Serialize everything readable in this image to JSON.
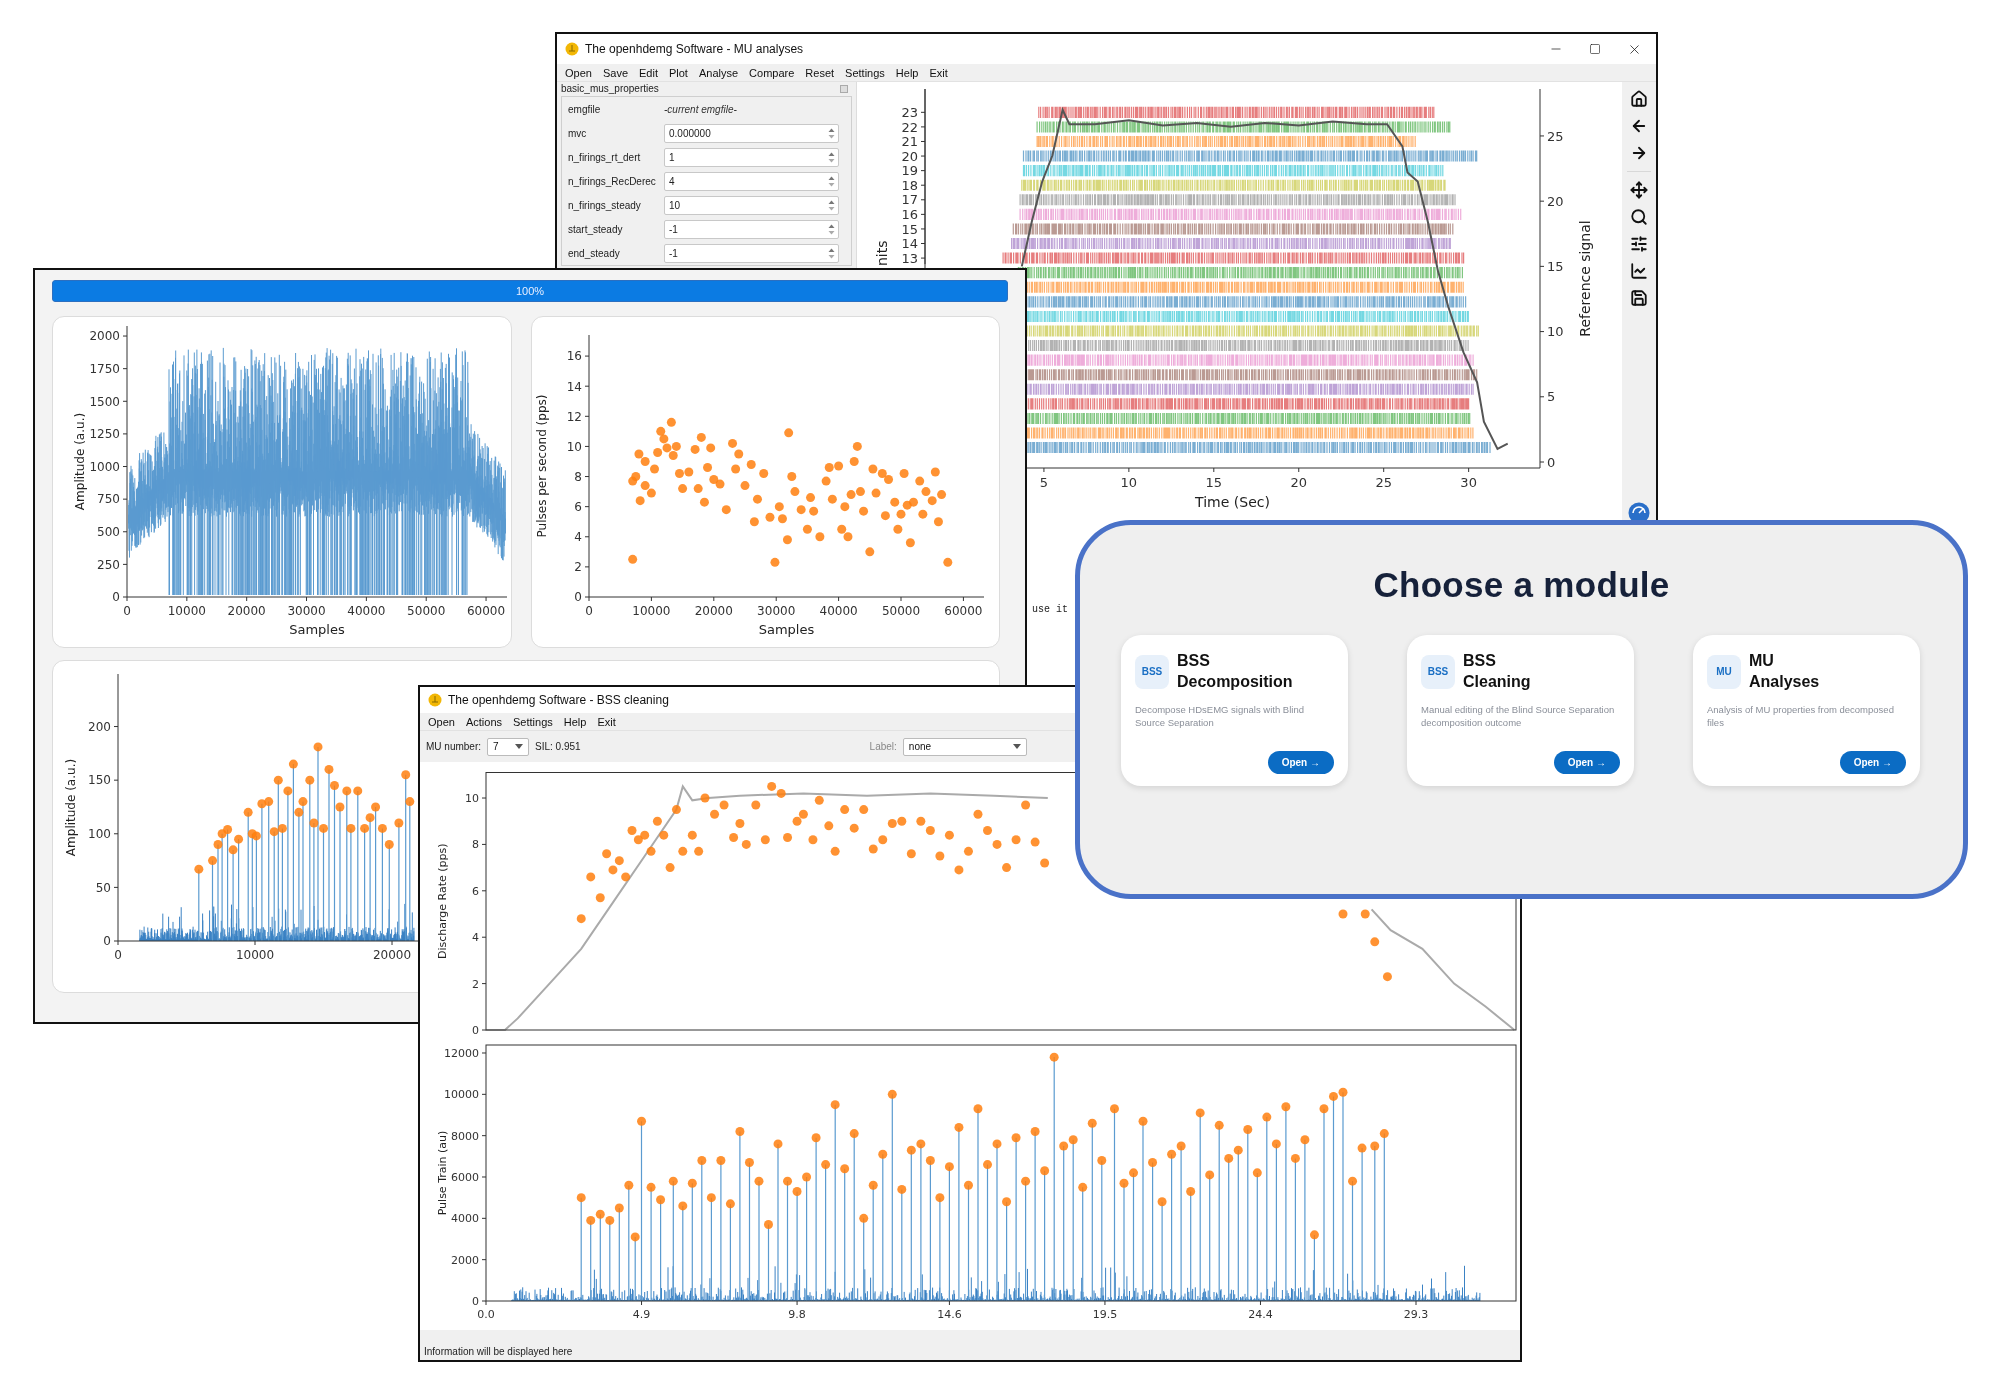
{
  "mu_window": {
    "title": "The openhdemg Software - MU analyses",
    "menu": [
      "Open",
      "Save",
      "Edit",
      "Plot",
      "Analyse",
      "Compare",
      "Reset",
      "Settings",
      "Help",
      "Exit"
    ],
    "panel": {
      "title": "basic_mus_properties",
      "fields": [
        {
          "label": "emgfile",
          "value": "-current emgfile-",
          "kind": "text"
        },
        {
          "label": "mvc",
          "value": "0.000000",
          "kind": "spin"
        },
        {
          "label": "n_firings_rt_dert",
          "value": "1",
          "kind": "spin"
        },
        {
          "label": "n_firings_RecDerec",
          "value": "4",
          "kind": "spin"
        },
        {
          "label": "n_firings_steady",
          "value": "10",
          "kind": "spin"
        },
        {
          "label": "start_steady",
          "value": "-1",
          "kind": "spin"
        },
        {
          "label": "end_steady",
          "value": "-1",
          "kind": "spin"
        }
      ]
    },
    "plot": {
      "kind": "raster",
      "unit_axis": {
        "label": "nits",
        "ticks": [
          "23",
          "22",
          "21",
          "20",
          "19",
          "18",
          "17",
          "16",
          "15",
          "14",
          "13"
        ]
      },
      "chart_data": {
        "type": "line",
        "xlabel": "Time (Sec)",
        "ylabel": "Reference signal",
        "xlim": [
          -2,
          34.2
        ],
        "ylim": [
          -0.46,
          28.6
        ],
        "xticks": [
          5,
          10,
          15,
          20,
          25,
          30
        ],
        "yticks": [
          0,
          5,
          10,
          15,
          20,
          25
        ],
        "series": [
          {
            "color": "#555555",
            "x": [
              3.7,
              4.3,
              4.9,
              5.5,
              6.1,
              6.5,
              8,
              10,
              12,
              14,
              16,
              18,
              20,
              22,
              24,
              25.2,
              26.1,
              26.4,
              27,
              27.6,
              28.2,
              28.8,
              29.7,
              30.5,
              30.9,
              31.7,
              32.3
            ],
            "values": [
              15,
              18.5,
              21.5,
              23.5,
              27,
              25.9,
              25.9,
              26.2,
              25.8,
              26,
              25.7,
              26,
              25.8,
              26.1,
              25.9,
              25.9,
              24.2,
              22.2,
              21.5,
              18.4,
              14.6,
              11.9,
              8.4,
              6.1,
              3.1,
              1.0,
              1.4
            ]
          }
        ]
      }
    },
    "console_text": "use it"
  },
  "progress_window": {
    "progress": {
      "label": "100%",
      "level": 1
    },
    "plots": [
      {
        "kind": "emg",
        "chart_data": {
          "type": "line",
          "xlabel": "Samples",
          "ylabel": "Amplitude (a.u.)",
          "xlim": [
            0,
            63500
          ],
          "ylim": [
            0,
            2077
          ],
          "xticks": [
            0,
            10000,
            20000,
            30000,
            40000,
            50000,
            60000
          ],
          "yticks": [
            0,
            250,
            500,
            750,
            1000,
            1250,
            1500,
            1750,
            2000
          ]
        }
      },
      {
        "kind": "plain",
        "chart_data": {
          "type": "scatter",
          "xlabel": "Samples",
          "ylabel": "Pulses per second (pps)",
          "xlim": [
            0,
            63300
          ],
          "ylim": [
            0,
            17.4
          ],
          "xticks": [
            0,
            10000,
            20000,
            30000,
            40000,
            50000,
            60000
          ],
          "yticks": [
            0,
            2,
            4,
            6,
            8,
            10,
            12,
            14,
            16
          ],
          "series": [
            {
              "color": "#ff7f0e",
              "x": [
                7000,
                7000,
                7500,
                8000,
                8200,
                9000,
                9000,
                10000,
                10500,
                11000,
                11500,
                12000,
                12500,
                13200,
                13500,
                14000,
                14500,
                15000,
                16000,
                17000,
                17500,
                18000,
                18500,
                19000,
                19500,
                20000,
                21000,
                22000,
                23000,
                23500,
                24000,
                25000,
                26000,
                26500,
                27000,
                28000,
                29000,
                29800,
                30500,
                31000,
                31800,
                32000,
                32500,
                33000,
                34000,
                35000,
                35500,
                36000,
                37000,
                38000,
                38500,
                39000,
                40000,
                40500,
                41000,
                41500,
                42000,
                42500,
                43000,
                43500,
                44000,
                45000,
                45500,
                46000,
                47000,
                47500,
                48000,
                49000,
                49500,
                50000,
                50500,
                51000,
                51500,
                52000,
                53000,
                53500,
                54000,
                55000,
                55500,
                56000,
                56500,
                57500
              ],
              "values": [
                2.5,
                7.7,
                8,
                9.5,
                6.4,
                9,
                7.4,
                6.9,
                8.5,
                9.6,
                11,
                10.5,
                9.9,
                11.6,
                9.4,
                10,
                8.2,
                7.2,
                8.3,
                9.8,
                7.2,
                10.6,
                6.3,
                8.6,
                9.9,
                7.8,
                7.5,
                5.8,
                10.2,
                8.5,
                9.5,
                7.4,
                8.8,
                5,
                6.5,
                8.2,
                5.3,
                2.3,
                6,
                5.2,
                3.8,
                10.9,
                8,
                7,
                5.8,
                4.5,
                6.6,
                5.7,
                4,
                7.7,
                8.6,
                6.5,
                8.7,
                4.5,
                6,
                4,
                6.8,
                9,
                10,
                7,
                5.7,
                3,
                8.5,
                6.9,
                8.2,
                5.4,
                7.8,
                6.3,
                4.5,
                5.5,
                8.2,
                6.1,
                3.6,
                6.3,
                7.7,
                5.5,
                7,
                6.4,
                8.3,
                5,
                6.8,
                2.3
              ]
            }
          ]
        }
      },
      {
        "kind": "stem_noise",
        "chart_data": {
          "type": "scatter",
          "ylabel": "Amplitude (a.u.)",
          "xlim": [
            0,
            63500
          ],
          "ylim": [
            0,
            249
          ],
          "xticks": [
            0,
            10000,
            20000
          ],
          "yticks": [
            0,
            50,
            100,
            150,
            200
          ],
          "series": [
            {
              "color": "#ff7f0e",
              "x": [
                5900,
                6900,
                7300,
                7600,
                8000,
                8400,
                8800,
                9500,
                9800,
                10100,
                10500,
                11000,
                11400,
                11700,
                12000,
                12400,
                12800,
                13200,
                13500,
                14000,
                14300,
                14600,
                15000,
                15400,
                15800,
                16200,
                16700,
                17000,
                17500,
                18000,
                18400,
                18800,
                19300,
                19800,
                20500,
                21000,
                21300
              ],
              "values": [
                67,
                75,
                90,
                100,
                104,
                85,
                95,
                120,
                100,
                98,
                128,
                130,
                102,
                150,
                105,
                140,
                165,
                120,
                130,
                150,
                110,
                181,
                105,
                160,
                145,
                125,
                140,
                105,
                140,
                105,
                115,
                125,
                105,
                90,
                110,
                155,
                130
              ]
            }
          ]
        }
      }
    ]
  },
  "bss_window": {
    "title": "The openhdemg Software - BSS cleaning",
    "menu": [
      "Open",
      "Actions",
      "Settings",
      "Help",
      "Exit"
    ],
    "mu_number": {
      "label": "MU number:",
      "value": "7"
    },
    "sil": "SIL: 0.951",
    "label_select": {
      "label": "Label:",
      "value": "none"
    },
    "plots": [
      {
        "kind": "plain",
        "chart_data": {
          "type": "scatter",
          "ylabel": "Discharge Rate (pps)",
          "xlim": [
            0,
            32.45
          ],
          "ylim": [
            0,
            11.1
          ],
          "yticks": [
            0,
            2,
            4,
            6,
            8,
            10
          ],
          "series": [
            {
              "type": "line",
              "color": "#aaaaaa",
              "x": [
                0,
                0.6,
                1,
                2,
                3,
                4,
                5,
                6,
                6.2,
                6.5,
                7,
                8,
                10,
                12,
                14,
                16,
                17.7
              ],
              "values": [
                0,
                0,
                0.5,
                2,
                3.5,
                5.5,
                7.5,
                9.5,
                10.5,
                9.9,
                10,
                10.1,
                10.2,
                10.1,
                10.2,
                10.1,
                10.0
              ]
            },
            {
              "type": "line",
              "color": "#aaaaaa",
              "x": [
                27.9,
                28.5,
                29.5,
                30.5,
                31.5,
                32.4
              ],
              "values": [
                5.2,
                4.3,
                3.5,
                2,
                1,
                0
              ]
            },
            {
              "color": "#ff7f0e",
              "x": [
                3.0,
                3.3,
                3.6,
                3.8,
                4,
                4.2,
                4.4,
                4.6,
                4.8,
                5,
                5.2,
                5.4,
                5.6,
                5.8,
                6,
                6.2,
                6.5,
                6.7,
                6.9,
                7.2,
                7.5,
                7.8,
                8,
                8.2,
                8.5,
                8.8,
                9,
                9.3,
                9.5,
                9.8,
                10,
                10.3,
                10.5,
                10.8,
                11,
                11.3,
                11.6,
                11.9,
                12.2,
                12.5,
                12.8,
                13.1,
                13.4,
                13.7,
                14,
                14.3,
                14.6,
                14.9,
                15.2,
                15.5,
                15.8,
                16.1,
                16.4,
                16.7,
                17,
                17.3,
                17.6,
                27.0,
                27.7,
                28.0,
                28.4
              ],
              "values": [
                4.8,
                6.6,
                5.7,
                7.6,
                6.9,
                7.3,
                6.6,
                8.6,
                8.2,
                8.4,
                7.7,
                9,
                8.4,
                7,
                9.5,
                7.7,
                8.4,
                7.7,
                10,
                9.3,
                9.7,
                8.3,
                8.9,
                8,
                9.7,
                8.2,
                10.5,
                10.2,
                8.3,
                9,
                9.3,
                8.2,
                9.9,
                8.8,
                7.7,
                9.5,
                8.7,
                9.5,
                7.8,
                8.2,
                8.9,
                9,
                7.6,
                9,
                8.6,
                7.5,
                8.4,
                6.9,
                7.7,
                9.3,
                8.6,
                8,
                7,
                8.2,
                9.7,
                8.1,
                7.2,
                5,
                5,
                3.8,
                2.3
              ]
            }
          ]
        }
      },
      {
        "kind": "stem_noise",
        "chart_data": {
          "type": "scatter",
          "ylabel": "Pulse Train (au)",
          "xlim": [
            0,
            32.45
          ],
          "ylim": [
            0,
            12387
          ],
          "xticks": [
            {
              "value": 0,
              "label": "0.0"
            },
            4.9,
            9.8,
            14.6,
            19.5,
            24.4,
            29.3
          ],
          "yticks": [
            0,
            2000,
            4000,
            6000,
            8000,
            10000,
            12000
          ],
          "series": [
            {
              "color": "#ff7f0e",
              "x": [
                3.0,
                3.3,
                3.6,
                3.9,
                4.2,
                4.5,
                4.7,
                4.9,
                5.2,
                5.5,
                5.9,
                6.2,
                6.5,
                6.8,
                7.1,
                7.4,
                7.7,
                8.0,
                8.3,
                8.6,
                8.9,
                9.2,
                9.5,
                9.8,
                10.1,
                10.4,
                10.7,
                11.0,
                11.3,
                11.6,
                11.9,
                12.2,
                12.5,
                12.8,
                13.1,
                13.4,
                13.7,
                14.0,
                14.3,
                14.6,
                14.9,
                15.2,
                15.5,
                15.8,
                16.1,
                16.4,
                16.7,
                17.0,
                17.3,
                17.6,
                17.9,
                18.2,
                18.5,
                18.8,
                19.1,
                19.4,
                19.8,
                20.1,
                20.4,
                20.7,
                21.0,
                21.3,
                21.6,
                21.9,
                22.2,
                22.5,
                22.8,
                23.1,
                23.4,
                23.7,
                24.0,
                24.3,
                24.6,
                24.9,
                25.2,
                25.5,
                25.8,
                26.1,
                26.4,
                26.7,
                27.0,
                27.3,
                27.6,
                28.0,
                28.3
              ],
              "values": [
                5000,
                3900,
                4200,
                3900,
                4500,
                5600,
                3100,
                8700,
                5500,
                4900,
                5800,
                4600,
                5700,
                6800,
                5000,
                6800,
                4700,
                8200,
                6700,
                5800,
                3700,
                7600,
                5800,
                5300,
                6000,
                7900,
                6600,
                9500,
                6400,
                8100,
                4000,
                5600,
                7100,
                10000,
                5400,
                7300,
                7600,
                6800,
                5000,
                6500,
                8400,
                5600,
                9300,
                6600,
                7600,
                4800,
                7900,
                5800,
                8200,
                6300,
                11800,
                7500,
                7800,
                5500,
                8600,
                6800,
                9300,
                5700,
                6200,
                8700,
                6700,
                4800,
                7100,
                7500,
                5300,
                9100,
                6100,
                8500,
                6900,
                7300,
                8300,
                6200,
                8900,
                7600,
                9400,
                6900,
                7800,
                3200,
                9300,
                9900,
                10100,
                5800,
                7400,
                7500,
                8100
              ]
            }
          ]
        }
      }
    ],
    "status": "Information will be displayed here"
  },
  "module_chooser": {
    "title": "Choose a module",
    "cards": [
      {
        "badge": "BSS",
        "title": "BSS Decomposition",
        "description": "Decompose HDsEMG signals with Blind Source Separation",
        "button": "Open →"
      },
      {
        "badge": "BSS",
        "title": "BSS Cleaning",
        "description": "Manual editing of the Blind Source Separation decomposition outcome",
        "button": "Open →"
      },
      {
        "badge": "MU",
        "title": "MU Analyses",
        "description": "Analysis of MU properties from decomposed files",
        "button": "Open →"
      }
    ]
  }
}
